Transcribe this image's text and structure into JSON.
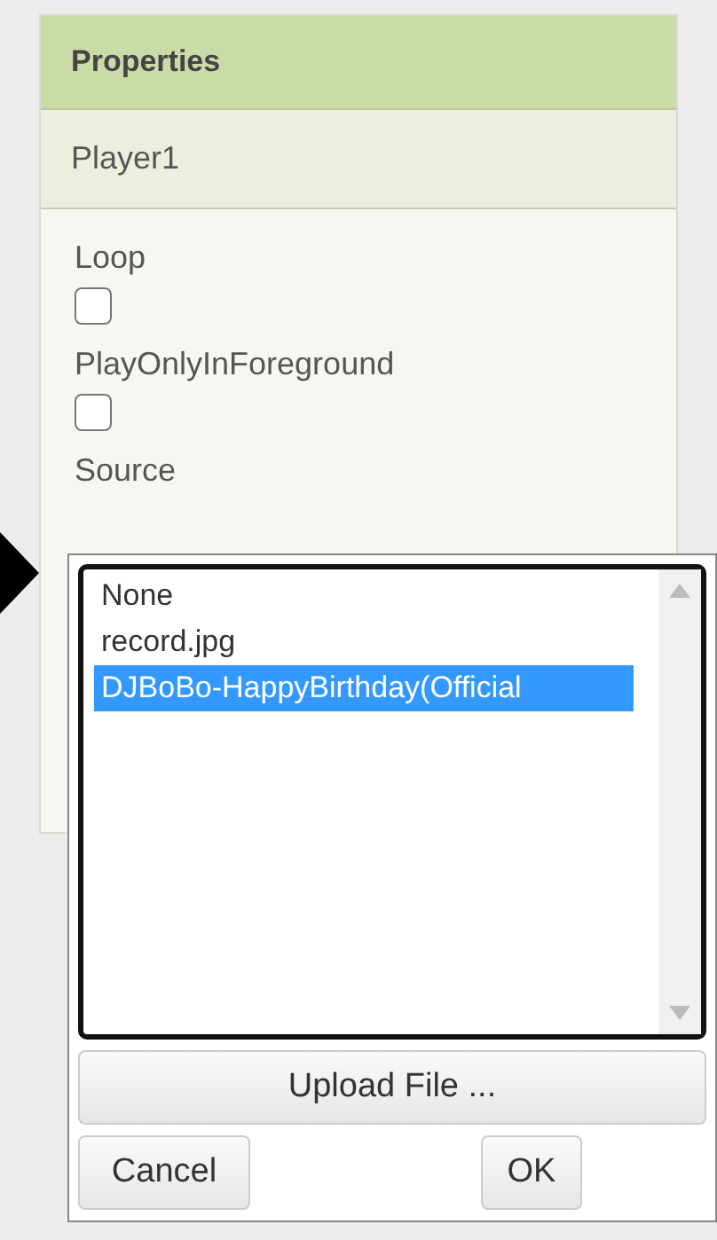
{
  "panel": {
    "title": "Properties",
    "component": "Player1"
  },
  "properties": [
    {
      "kind": "checkbox",
      "label": "Loop",
      "checked": false
    },
    {
      "kind": "checkbox",
      "label": "PlayOnlyInForeground",
      "checked": false
    },
    {
      "kind": "picker",
      "label": "Source"
    }
  ],
  "popup": {
    "items": [
      {
        "label": "None",
        "selected": false
      },
      {
        "label": "record.jpg",
        "selected": false
      },
      {
        "label": "DJBoBo-HappyBirthday(Official",
        "selected": true
      }
    ],
    "upload_button": "Upload File ...",
    "cancel_button": "Cancel",
    "ok_button": "OK"
  }
}
